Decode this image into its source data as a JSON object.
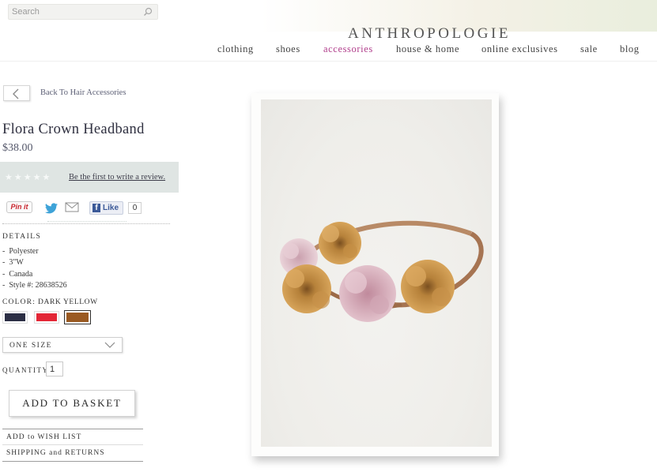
{
  "header": {
    "search": {
      "placeholder": "Search",
      "icon": "search-icon"
    },
    "logo": "ANTHROPOLOGIE",
    "nav": [
      {
        "label": "clothing",
        "active": false
      },
      {
        "label": "shoes",
        "active": false
      },
      {
        "label": "accessories",
        "active": true
      },
      {
        "label": "house & home",
        "active": false
      },
      {
        "label": "online exclusives",
        "active": false
      },
      {
        "label": "sale",
        "active": false
      },
      {
        "label": "blog",
        "active": false
      }
    ],
    "active_color": "#b13f8c"
  },
  "product": {
    "back_link": "Back To Hair Accessories",
    "title": "Flora Crown Headband",
    "price": "$38.00",
    "review_prompt": "Be the first to write a review.",
    "rating_stars": 0,
    "social": {
      "pinit": "Pin it",
      "facebook_like": "Like",
      "like_count": "0"
    },
    "details_heading": "DETAILS",
    "details": [
      "Polyester",
      "3\"W",
      "Canada",
      "Style #: 28638526"
    ],
    "color_label": "COLOR:",
    "selected_color": "DARK YELLOW",
    "swatches": [
      {
        "name": "navy",
        "hex": "#2c2f45",
        "selected": false
      },
      {
        "name": "red",
        "hex": "#e32636",
        "selected": false
      },
      {
        "name": "dark-yellow",
        "hex": "#9a5a22",
        "selected": true
      }
    ],
    "size": "ONE SIZE",
    "quantity_label": "QUANTITY:",
    "quantity": "1",
    "add_to_basket": "ADD TO BASKET",
    "wish_list": "ADD to WISH LIST",
    "shipping": "SHIPPING and RETURNS"
  },
  "image": {
    "subject": "flower-crown-headband-photo",
    "flower_colors": [
      "#c98f3f",
      "#d6a6b5",
      "#8a5a2a"
    ]
  }
}
